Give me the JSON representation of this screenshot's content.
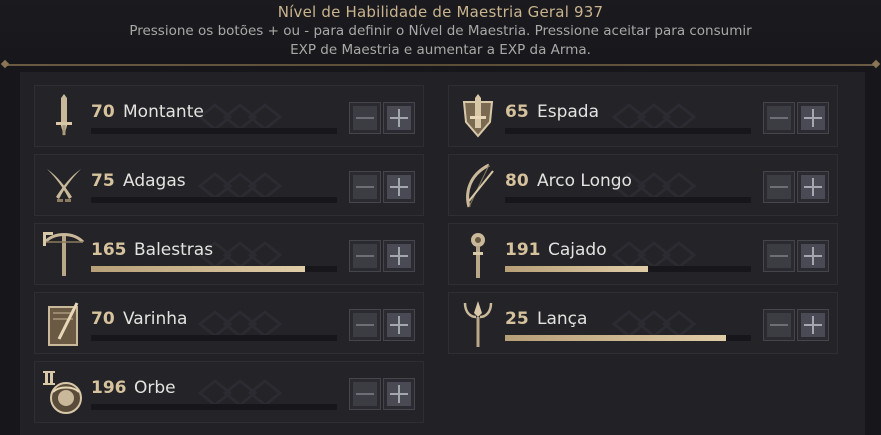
{
  "header": {
    "title": "Nível de Habilidade de Maestria Geral 937",
    "instruction_line1": "Pressione os botões + ou - para definir o Nível de Maestria. Pressione aceitar para consumir",
    "instruction_line2": "EXP de Maestria e aumentar a EXP da Arma."
  },
  "weapons": [
    {
      "level": "70",
      "name": "Montante",
      "icon": "greatsword-icon",
      "progress": 0.0
    },
    {
      "level": "65",
      "name": "Espada",
      "icon": "sword-shield-icon",
      "progress": 0.0
    },
    {
      "level": "75",
      "name": "Adagas",
      "icon": "daggers-icon",
      "progress": 0.0
    },
    {
      "level": "80",
      "name": "Arco Longo",
      "icon": "longbow-icon",
      "progress": 0.0
    },
    {
      "level": "165",
      "name": "Balestras",
      "icon": "crossbow-icon",
      "progress": 0.87
    },
    {
      "level": "191",
      "name": "Cajado",
      "icon": "staff-icon",
      "progress": 0.58
    },
    {
      "level": "70",
      "name": "Varinha",
      "icon": "wand-tome-icon",
      "progress": 0.0
    },
    {
      "level": "25",
      "name": "Lança",
      "icon": "spear-icon",
      "progress": 0.9
    },
    {
      "level": "196",
      "name": "Orbe",
      "icon": "orb-icon",
      "progress": 0.0
    }
  ],
  "buttons": {
    "minus": "−",
    "plus": "+"
  },
  "colors": {
    "accent": "#d6c29d",
    "progress": "#d8c4a0",
    "background": "#17171b"
  }
}
